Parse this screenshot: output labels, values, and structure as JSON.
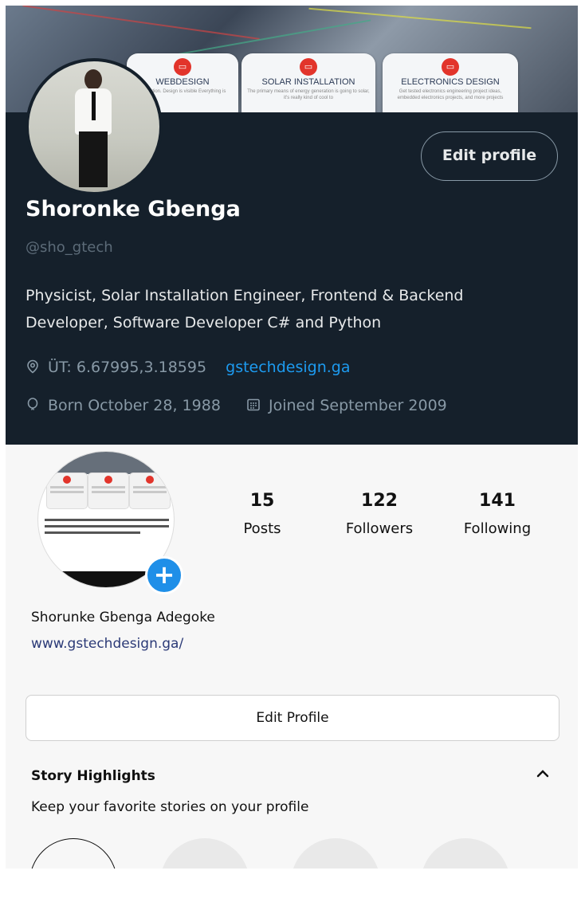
{
  "twitter": {
    "banner": {
      "cards": [
        {
          "title": "WEBDESIGN",
          "desc": "perfection. Design is visible Everything is"
        },
        {
          "title": "SOLAR INSTALLATION",
          "desc": "The primary means of energy generation is going to solar, it's really kind of cool to"
        },
        {
          "title": "ELECTRONICS DESIGN",
          "desc": "Get tested electronics engineering project ideas, embedded electronics projects, and more projects"
        }
      ]
    },
    "edit_profile_label": "Edit profile",
    "name": "Shoronke Gbenga",
    "handle": "@sho_gtech",
    "bio": "Physicist, Solar Installation Engineer, Frontend & Backend Developer, Software Developer C# and Python",
    "location": "ÜT: 6.67995,3.18595",
    "website": "gstechdesign.ga",
    "born": "Born October 28, 1988",
    "joined": "Joined September 2009",
    "icons": {
      "location": "location-pin-icon",
      "birthday": "balloon-icon",
      "joined": "calendar-icon"
    },
    "colors": {
      "background": "#15202b",
      "link": "#1d9bf0",
      "muted": "#8899a6"
    }
  },
  "instagram": {
    "stats": [
      {
        "value": "15",
        "label": "Posts"
      },
      {
        "value": "122",
        "label": "Followers"
      },
      {
        "value": "141",
        "label": "Following"
      }
    ],
    "full_name": "Shorunke Gbenga Adegoke",
    "website": "www.gstechdesign.ga/",
    "edit_profile_label": "Edit Profile",
    "highlights": {
      "title": "Story Highlights",
      "subtitle": "Keep your favorite stories on your profile",
      "new_label": "+"
    },
    "colors": {
      "accent": "#1f8fe8"
    }
  }
}
